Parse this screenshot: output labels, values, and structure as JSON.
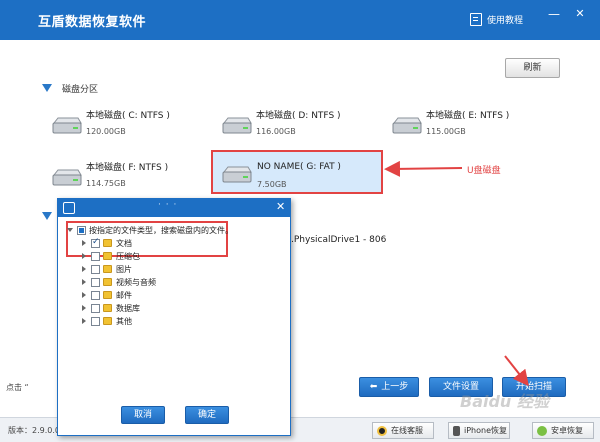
{
  "window": {
    "title": "互盾数据恢复软件",
    "tutorial_label": "使用教程",
    "minimize_glyph": "—",
    "close_glyph": "✕"
  },
  "toolbar": {
    "refresh_label": "刷新"
  },
  "sections": {
    "disk_partition": "磁盘分区"
  },
  "drives": [
    {
      "name": "本地磁盘( C: NTFS )",
      "size": "120.00GB",
      "selected": false
    },
    {
      "name": "本地磁盘( D: NTFS )",
      "size": "116.00GB",
      "selected": false
    },
    {
      "name": "本地磁盘( E: NTFS )",
      "size": "115.00GB",
      "selected": false
    },
    {
      "name": "本地磁盘( F: NTFS )",
      "size": "114.75GB",
      "selected": false
    },
    {
      "name": "NO NAME( G: FAT )",
      "size": "7.50GB",
      "selected": true
    }
  ],
  "annotation": {
    "u_disk_label": "U盘磁盘"
  },
  "physical_drive": ".PhysicalDrive1 - 806",
  "bottom_hint": "点击 “",
  "actions": {
    "prev_label": "上一步",
    "file_settings_label": "文件设置",
    "start_scan_label": "开始扫描"
  },
  "status": {
    "version": "版本：2.9.0.0",
    "online_service": "在线客服",
    "iphone_recovery": "iPhone恢复",
    "android_recovery": "安卓恢复"
  },
  "dialog": {
    "dots": "· · ·",
    "close_glyph": "✕",
    "root_label": "按指定的文件类型，搜索磁盘内的文件。",
    "items": [
      {
        "label": "文档",
        "checked": true
      },
      {
        "label": "压缩包",
        "checked": false
      },
      {
        "label": "图片",
        "checked": false
      },
      {
        "label": "视频与音频",
        "checked": false
      },
      {
        "label": "邮件",
        "checked": false
      },
      {
        "label": "数据库",
        "checked": false
      },
      {
        "label": "其他",
        "checked": false
      }
    ],
    "cancel_label": "取消",
    "ok_label": "确定"
  },
  "watermark": "Baidu 经验",
  "colors": {
    "brand_blue": "#1d6fc4",
    "annotation_red": "#e24343",
    "selected_bg": "#d6e9fb"
  }
}
